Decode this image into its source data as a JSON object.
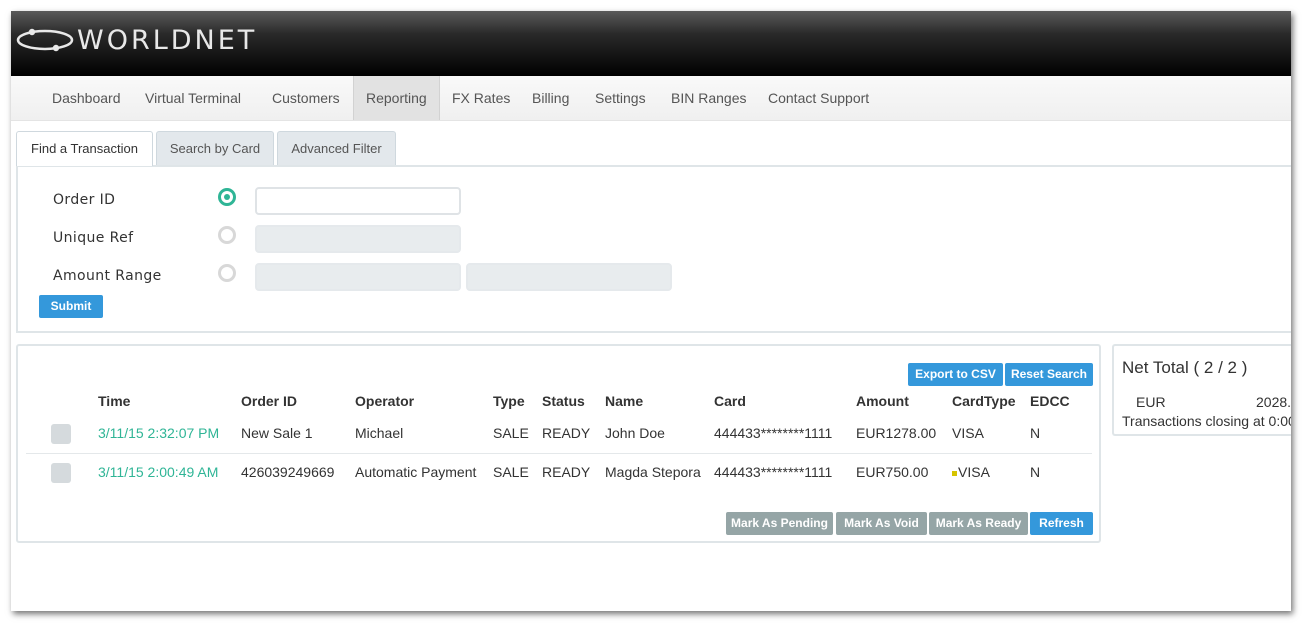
{
  "app": {
    "logo_text": "WORLDNET"
  },
  "nav": {
    "items": [
      "Dashboard",
      "Virtual Terminal",
      "Customers",
      "Reporting",
      "FX Rates",
      "Billing",
      "Settings",
      "BIN Ranges",
      "Contact Support"
    ],
    "active": "Reporting"
  },
  "search": {
    "tabs": [
      "Find a Transaction",
      "Search by Card",
      "Advanced Filter"
    ],
    "active_tab": "Find a Transaction",
    "fields": [
      {
        "label": "Order ID",
        "selected": true,
        "value": ""
      },
      {
        "label": "Unique Ref",
        "selected": false,
        "value": ""
      },
      {
        "label": "Amount Range",
        "selected": false,
        "value_from": "",
        "value_to": ""
      }
    ],
    "submit_label": "Submit"
  },
  "results": {
    "export_label": "Export to CSV",
    "reset_label": "Reset Search",
    "columns": [
      "Time",
      "Order ID",
      "Operator",
      "Type",
      "Status",
      "Name",
      "Card",
      "Amount",
      "CardType",
      "EDCC"
    ],
    "rows": [
      {
        "time": "3/11/15 2:32:07 PM",
        "order_id": "New Sale 1",
        "operator": "Michael",
        "type": "SALE",
        "status": "READY",
        "name": "John Doe",
        "card": "444433********1111",
        "amount": "EUR1278.00",
        "card_type": "VISA",
        "edcc": "N"
      },
      {
        "time": "3/11/15 2:00:49 AM",
        "order_id": "426039249669",
        "operator": "Automatic Payment",
        "type": "SALE",
        "status": "READY",
        "name": "Magda Stepora",
        "card": "444433********1111",
        "amount": "EUR750.00",
        "card_type": "VISA",
        "edcc": "N"
      }
    ],
    "actions": {
      "pending": "Mark As Pending",
      "void": "Mark As Void",
      "ready": "Mark As Ready",
      "refresh": "Refresh"
    }
  },
  "net_total": {
    "title": "Net Total ( 2 / 2 )",
    "currency": "EUR",
    "amount": "2028.",
    "closing": "Transactions closing at 0:00"
  },
  "colors": {
    "accent_green": "#2fb596",
    "button_blue": "#3498db",
    "button_gray": "#95a5a6"
  }
}
